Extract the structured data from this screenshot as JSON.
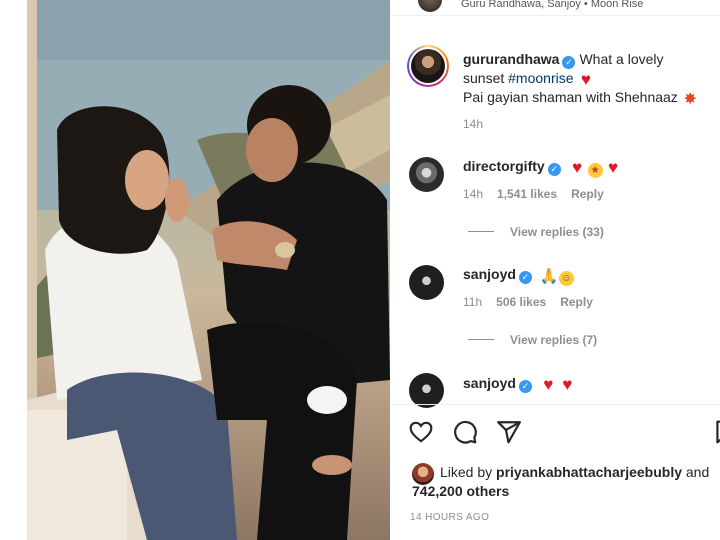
{
  "header": {
    "audio_text": "Guru Randhawa, Sanjoy • Moon Rise"
  },
  "caption": {
    "username": "gururandhawa",
    "line1_text": "What a lovely",
    "line2_prefix": "sunset",
    "hashtag": "#moonrise",
    "line3_text": "Pai gayian shaman with Shehnaaz",
    "time": "14h"
  },
  "comments": [
    {
      "username": "directorgifty",
      "time": "14h",
      "likes": "1,541 likes",
      "reply_label": "Reply",
      "view_replies": "View replies (33)",
      "emojis": [
        "red-heart",
        "star-struck-face",
        "red-heart"
      ]
    },
    {
      "username": "sanjoyd",
      "time": "11h",
      "likes": "506 likes",
      "reply_label": "Reply",
      "view_replies": "View replies (7)",
      "emojis": [
        "folded-hands",
        "smiling-face"
      ]
    },
    {
      "username": "sanjoyd",
      "emojis": [
        "red-heart",
        "red-heart"
      ]
    }
  ],
  "actions": {
    "icons": [
      "heart-outline-icon",
      "comment-icon",
      "share-icon",
      "save-icon"
    ]
  },
  "likes_summary": {
    "prefix": "Liked by",
    "user": "priyankabhattacharjeebubly",
    "suffix": "and",
    "others": "742,200 others"
  },
  "post_time": "14 HOURS AGO",
  "colors": {
    "verified_blue": "#3897f0",
    "heart_red": "#ed1c2e",
    "hashtag_blue": "#00376b",
    "muted_text": "#8e8e8e"
  }
}
